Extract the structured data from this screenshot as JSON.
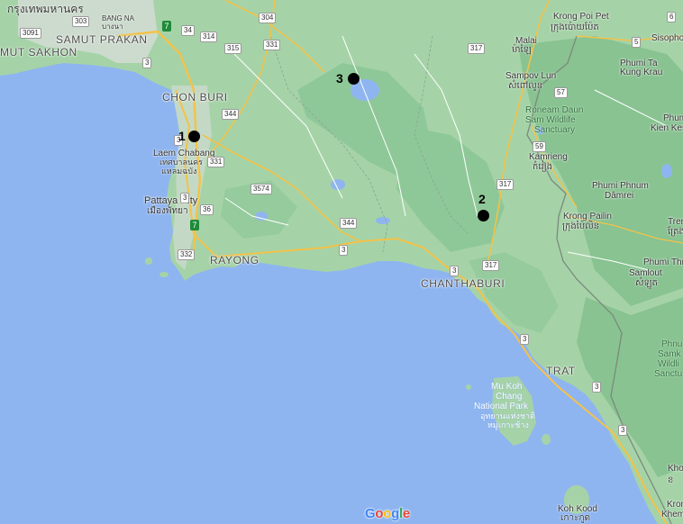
{
  "map": {
    "attribution": "Google",
    "logo_letters": [
      {
        "ch": "G",
        "color": "#4285F4"
      },
      {
        "ch": "o",
        "color": "#EA4335"
      },
      {
        "ch": "o",
        "color": "#FBBC05"
      },
      {
        "ch": "g",
        "color": "#4285F4"
      },
      {
        "ch": "l",
        "color": "#34A853"
      },
      {
        "ch": "e",
        "color": "#EA4335"
      }
    ],
    "colors": {
      "water": "#8fb5f0",
      "land": "#a6d3a8",
      "forest": "#86c28f",
      "highway": "#f3c24a",
      "road": "#ffffff",
      "border": "#7a7a7a"
    }
  },
  "markers": [
    {
      "label": "1"
    },
    {
      "label": "2"
    },
    {
      "label": "3"
    }
  ],
  "places": {
    "bangkok_thai": "กรุงเทพมหานคร",
    "bang_na": "BANG NA",
    "bang_na_thai": "บางนา",
    "samut_prakan": "SAMUT PRAKAN",
    "samut_sakhon": "MUT SAKHON",
    "chon_buri": "CHON BURI",
    "laem_chabang": "Laem Chabang",
    "laem_chabang_thai1": "เทศบาลนคร",
    "laem_chabang_thai2": "แหลมฉบัง",
    "pattaya": "Pattaya City",
    "pattaya_thai": "เมืองพัทยา",
    "rayong": "RAYONG",
    "chanthaburi": "CHANTHABURI",
    "trat": "TRAT",
    "krong_poi_pet": "Krong Poi Pet",
    "krong_poi_pet_khmer": "ក្រុងប៉ោយប៉ែត",
    "malai": "Malai",
    "malai_khmer": "ម៉ាឡៃ",
    "sisopho": "Sisopho",
    "phumi_ta_kung_krau_1": "Phumi Ta",
    "phumi_ta_kung_krau_2": "Kung Krau",
    "sampov_lun": "Sampov Lun",
    "sampov_lun_khmer": "សំពៅលូន",
    "roneam_1": "Roneam Daun",
    "roneam_2": "Sam Wildlife",
    "roneam_3": "Sanctuary",
    "phumi_kien_kes_1": "Phumi",
    "phumi_kien_kes_2": "Kien Kes",
    "kamrieng": "Kamrieng",
    "kamrieng_khmer": "កំរៀង",
    "phumi_phnum_1": "Phumi Phnum",
    "phumi_phnum_2": "Dâmrei",
    "krong_pailin": "Krong Pailin",
    "krong_pailin_khmer": "ក្រុងប៉ៃលិន",
    "treng": "Treng",
    "treng_khmer": "ត្រែង",
    "phumi_thn": "Phumi Thn",
    "samlout": "Samlout",
    "samlout_khmer": "សំឡូត",
    "samkos_1": "Phnu",
    "samkos_2": "Samk",
    "samkos_3": "Wildli",
    "samkos_4": "Sanctu",
    "mu_koh_chang_1": "Mu Koh",
    "mu_koh_chang_2": "Chang",
    "mu_koh_chang_3": "National Park",
    "mu_koh_chang_thai1": "อุทยานแห่งชาติ",
    "mu_koh_chang_thai2": "หมู่เกาะช้าง",
    "koh_kood": "Koh Kood",
    "koh_kood_thai": "เกาะกูด",
    "krong_khema_1": "Krong",
    "krong_khema_2": "Khema",
    "kho_1": "Kho",
    "kho_khmer": "ខ"
  },
  "road_shields": {
    "r303": "303",
    "r3091": "3091",
    "r7a": "7",
    "r304": "304",
    "r34": "34",
    "r314": "314",
    "r315": "315",
    "r3": "3",
    "r344a": "344",
    "r331a": "331",
    "r3574": "3574",
    "r36": "36",
    "r344b": "344",
    "r3a": "3",
    "r3b": "3",
    "r317a": "317",
    "r317b": "317",
    "r317c": "317",
    "r57": "57",
    "r57b": "57",
    "r59": "59",
    "r5": "5",
    "r6": "6",
    "r7b": "7",
    "r332": "332",
    "r331b": "331",
    "r3c": "3",
    "r3d": "3",
    "r3e": "3",
    "r3f": "3",
    "r3g": "3",
    "r1": "1",
    "r2": "2"
  }
}
